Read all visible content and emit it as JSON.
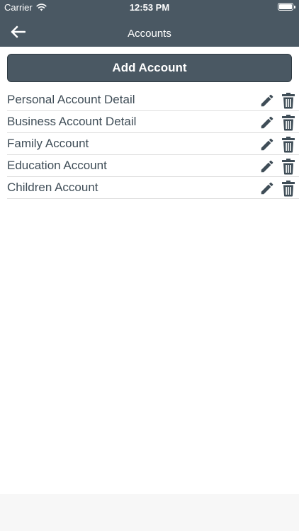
{
  "status_bar": {
    "carrier": "Carrier",
    "time": "12:53 PM"
  },
  "nav": {
    "title": "Accounts",
    "back_icon": "arrow-left-icon"
  },
  "add_button": {
    "label": "Add Account"
  },
  "accounts": [
    {
      "label": "Personal Account Detail"
    },
    {
      "label": "Business Account Detail"
    },
    {
      "label": "Family Account"
    },
    {
      "label": "Education Account"
    },
    {
      "label": "Children Account"
    }
  ],
  "icons": {
    "edit": "pencil-icon",
    "delete": "trash-icon"
  },
  "colors": {
    "header": "#4a5863",
    "text": "#3f4d57",
    "divider": "#dddddd",
    "bottom_area": "#f7f7f7"
  }
}
